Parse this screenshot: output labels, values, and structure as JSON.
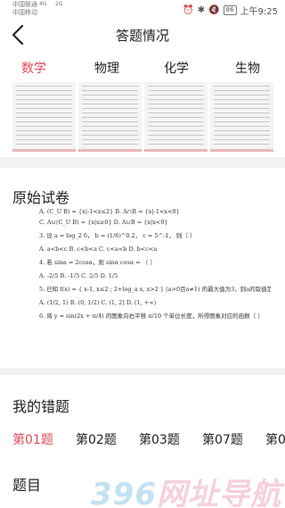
{
  "status": {
    "carrier1": "中国联通",
    "carrier2": "中国移动",
    "net1": "4G",
    "net2": "2G",
    "battery": "86",
    "time": "上午9:25"
  },
  "header": {
    "title": "答题情况"
  },
  "tabs": [
    "数学",
    "物理",
    "化学",
    "生物"
  ],
  "sections": {
    "original": "原始试卷",
    "wrong": "我的错题",
    "question": "题目"
  },
  "paper_lines": [
    "A.  (C_U B) = {x|-1<x≤2}              B.  A∩B = {x|-1<x<0}",
    "C.  A∪(C_U B) = {x|x≥0}               D.  A∪B = {x|x<0}",
    "3. 设 a = log_2 6，  b = (1/6)^0.2，  c = 5^-1，  则（   ）",
    "A.  a<b<c        B.  c<b<a        C.  c<a<b        D.  b<c<a",
    "4. 若 sinα = 2cosα，则 sinα cosα = （   ）",
    "A.  -2/5              B.  -1/5              C.  2/5              D.  1/5",
    "5. 已知 f(x) = { x-1, x≤2 ;  2+log_a x, x>2 }  (a>0且a≠1) 的最大值为3，则a的取值范围是",
    "A.  (1/2, 1)           B.  (0, 1/2)          C.  (1, 2]           D.  (1, +∞)",
    "6. 将 y = sin(2x + π/4) 的图象向右平移 π/10 个单位长度，所得图象对应的函数（   ）"
  ],
  "wrong_questions": [
    "第01题",
    "第02题",
    "第03题",
    "第07题",
    "第0"
  ],
  "watermark": {
    "part1": "396",
    "part2": "网址导航"
  }
}
